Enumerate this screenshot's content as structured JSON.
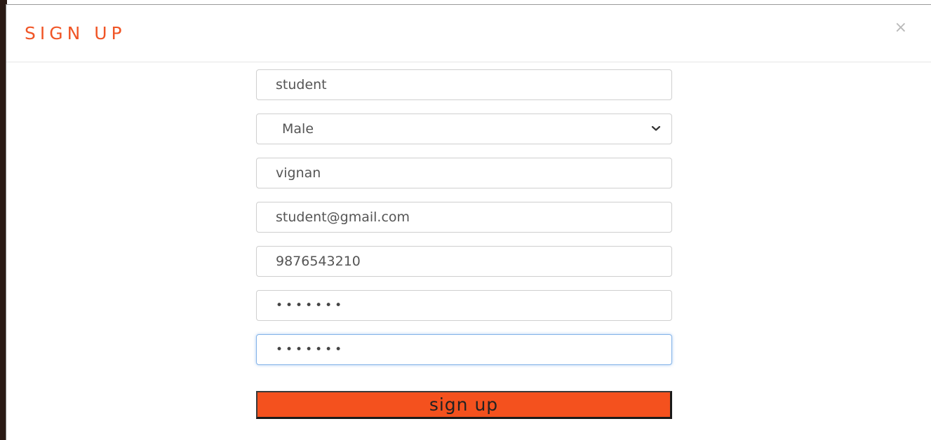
{
  "modal": {
    "title": "SIGN UP",
    "close_glyph": "×"
  },
  "form": {
    "name": "student",
    "gender": {
      "selected": "Male"
    },
    "college": "vignan",
    "email": "student@gmail.com",
    "phone": "9876543210",
    "password": "•••••••",
    "confirm_password": "•••••••"
  },
  "submit_label": "sign up",
  "colors": {
    "accent": "#f4511e",
    "title": "#f05526",
    "focus_border": "#84b3e8"
  }
}
